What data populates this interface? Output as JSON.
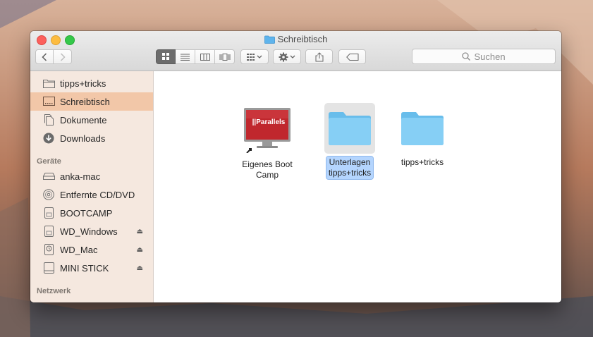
{
  "window": {
    "title": "Schreibtisch"
  },
  "toolbar": {
    "back_icon": "chevron-left-icon",
    "forward_icon": "chevron-right-icon",
    "search_placeholder": "Suchen"
  },
  "sidebar": {
    "favorites": [
      {
        "label": "tipps+tricks",
        "icon": "folder-icon"
      },
      {
        "label": "Schreibtisch",
        "icon": "desktop-icon",
        "selected": true
      },
      {
        "label": "Dokumente",
        "icon": "document-icon"
      },
      {
        "label": "Downloads",
        "icon": "download-icon"
      }
    ],
    "devices_heading": "Geräte",
    "devices": [
      {
        "label": "anka-mac",
        "icon": "harddisk-icon",
        "eject": false
      },
      {
        "label": "Entfernte CD/DVD",
        "icon": "disc-icon",
        "eject": false
      },
      {
        "label": "BOOTCAMP",
        "icon": "drive-icon",
        "eject": false
      },
      {
        "label": "WD_Windows",
        "icon": "drive-icon",
        "eject": true
      },
      {
        "label": "WD_Mac",
        "icon": "timemachine-drive-icon",
        "eject": true
      },
      {
        "label": "MINI STICK",
        "icon": "usb-drive-icon",
        "eject": true
      }
    ],
    "network_heading": "Netzwerk",
    "eject_symbol": "⏏"
  },
  "content": {
    "items": [
      {
        "label_line1": "Eigenes Boot",
        "label_line2": "Camp",
        "icon": "parallels-app-alias-icon",
        "brand": "||Parallels",
        "selected": false
      },
      {
        "label_line1": "Unterlagen",
        "label_line2": "tipps+tricks",
        "icon": "folder-icon",
        "selected": true
      },
      {
        "label_line1": "tipps+tricks",
        "label_line2": "",
        "icon": "folder-icon",
        "selected": false
      }
    ]
  },
  "colors": {
    "sidebar_bg": "#f5e8df",
    "sidebar_selected": "#f2c7a8",
    "folder_blue": "#6cc4f0",
    "selection_blue": "#b4d5fe",
    "parallels_red": "#c0272d"
  }
}
